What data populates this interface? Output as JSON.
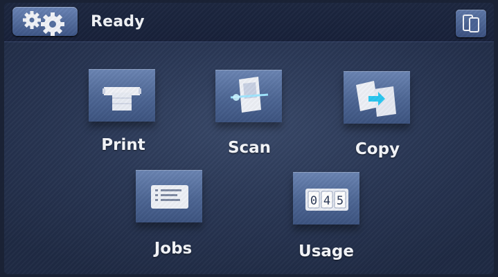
{
  "header": {
    "status_text": "Ready"
  },
  "tiles": [
    {
      "label": "Print",
      "icon": "print-icon"
    },
    {
      "label": "Scan",
      "icon": "scan-icon"
    },
    {
      "label": "Copy",
      "icon": "copy-icon"
    },
    {
      "label": "Jobs",
      "icon": "jobs-icon"
    },
    {
      "label": "Usage",
      "icon": "usage-counter-icon"
    }
  ],
  "usage_counter": {
    "digits": [
      "0",
      "4",
      "5"
    ]
  },
  "colors": {
    "background": "#2b3957",
    "tile": "#5a73a3",
    "text": "#f5f7fb"
  }
}
